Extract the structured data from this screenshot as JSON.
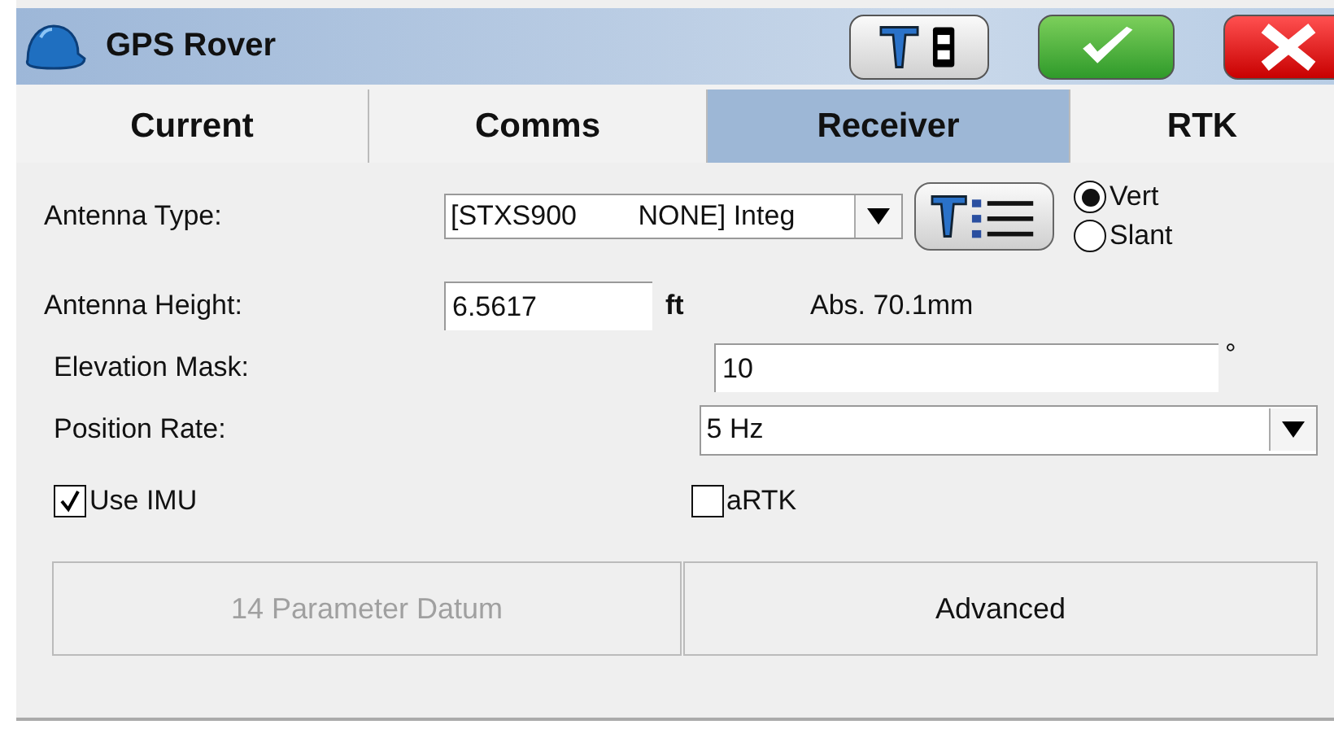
{
  "window": {
    "title": "GPS Rover"
  },
  "toolbar": [
    {
      "kind": "antenna"
    },
    {
      "kind": "ok"
    },
    {
      "kind": "cancel"
    }
  ],
  "tabs": [
    {
      "label": "Current",
      "selected": false
    },
    {
      "label": "Comms",
      "selected": false
    },
    {
      "label": "Receiver",
      "selected": true
    },
    {
      "label": "RTK",
      "selected": false
    }
  ],
  "antenna_type": {
    "label": "Antenna Type:",
    "value": "[STXS900        NONE] Integ"
  },
  "orientation": [
    {
      "label": "Vert",
      "selected": true
    },
    {
      "label": "Slant",
      "selected": false
    }
  ],
  "antenna_height": {
    "label": "Antenna Height:",
    "value": "6.5617",
    "unit": "ft",
    "absolute": "Abs. 70.1mm"
  },
  "elevation_mask": {
    "label": "Elevation Mask:",
    "value": "10",
    "unit": "°"
  },
  "position_rate": {
    "label": "Position Rate:",
    "value": "5 Hz"
  },
  "options": [
    {
      "label": "Use IMU",
      "checked": true
    },
    {
      "label": "aRTK",
      "checked": false
    }
  ],
  "buttons": [
    {
      "label": "14 Parameter Datum",
      "disabled": true
    },
    {
      "label": "Advanced",
      "disabled": false
    }
  ]
}
